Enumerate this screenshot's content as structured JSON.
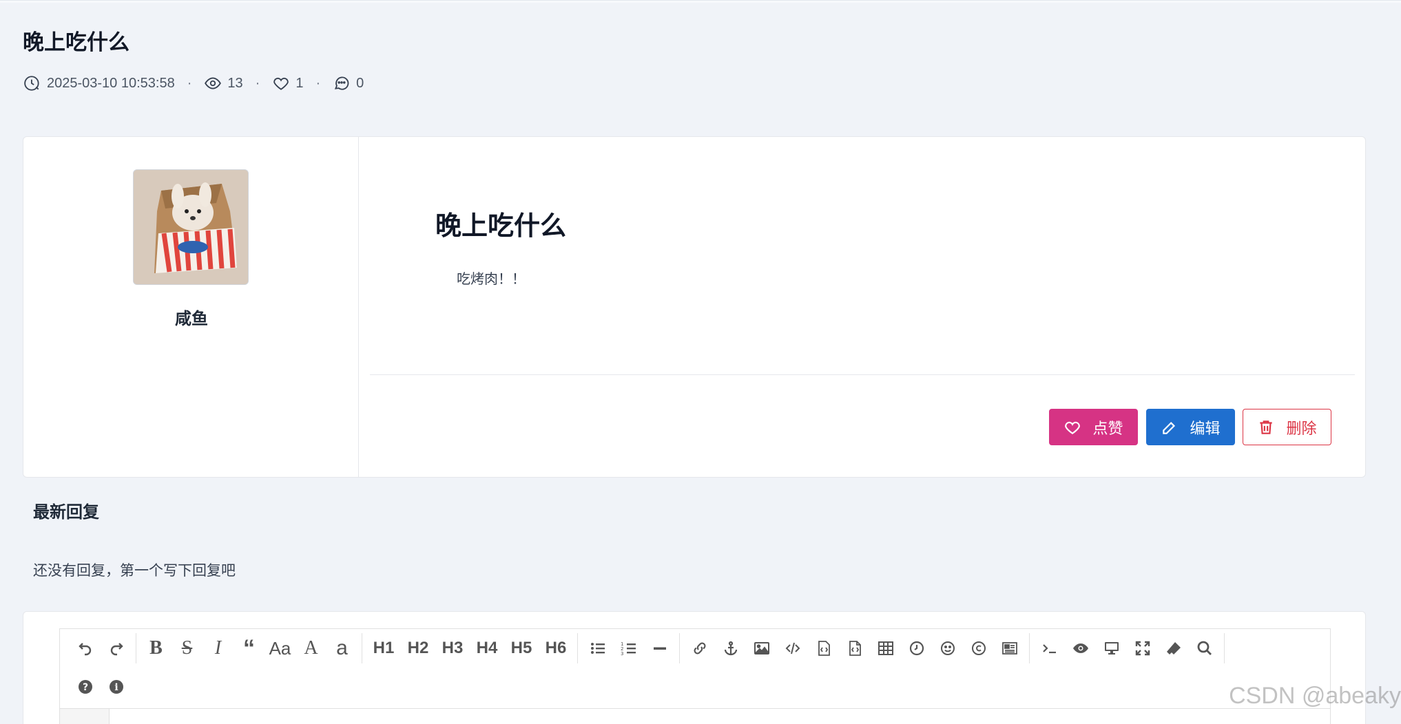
{
  "post": {
    "title": "晚上吃什么",
    "datetime": "2025-03-10 10:53:58",
    "views": "13",
    "likes": "1",
    "comments": "0",
    "heading": "晚上吃什么",
    "body": "吃烤肉！！"
  },
  "author": {
    "name": "咸鱼"
  },
  "actions": {
    "like_label": "点赞",
    "edit_label": "编辑",
    "delete_label": "删除"
  },
  "replies": {
    "title": "最新回复",
    "empty_text": "还没有回复，第一个写下回复吧"
  },
  "editor": {
    "toolbar_row1": [
      "undo-icon",
      "redo-icon",
      "bold",
      "strikethrough",
      "italic",
      "quote-icon",
      "Aa",
      "A",
      "a",
      "H1",
      "H2",
      "H3",
      "H4",
      "H5",
      "H6",
      "list-ul-icon",
      "list-ol-icon",
      "hr-icon",
      "link-icon",
      "anchor-icon",
      "image-icon",
      "code-icon",
      "code-block-icon",
      "code-file-icon",
      "table-icon",
      "datetime-icon",
      "emoji-icon",
      "copyright-icon",
      "pagebreak-icon",
      "terminal-icon",
      "preview-icon",
      "desktop-icon",
      "fullscreen-icon",
      "eraser-icon",
      "search-icon"
    ],
    "toolbar_row2": [
      "help-icon",
      "info-icon"
    ],
    "heading_labels": {
      "h1": "H1",
      "h2": "H2",
      "h3": "H3",
      "h4": "H4",
      "h5": "H5",
      "h6": "H6"
    },
    "case_labels": {
      "aa": "Aa",
      "upper": "A",
      "lower": "a"
    }
  },
  "watermark": "CSDN @abeaky",
  "colors": {
    "like": "#d63384",
    "edit": "#1f6fcf",
    "delete": "#dc3545",
    "background": "#f0f3f8"
  }
}
